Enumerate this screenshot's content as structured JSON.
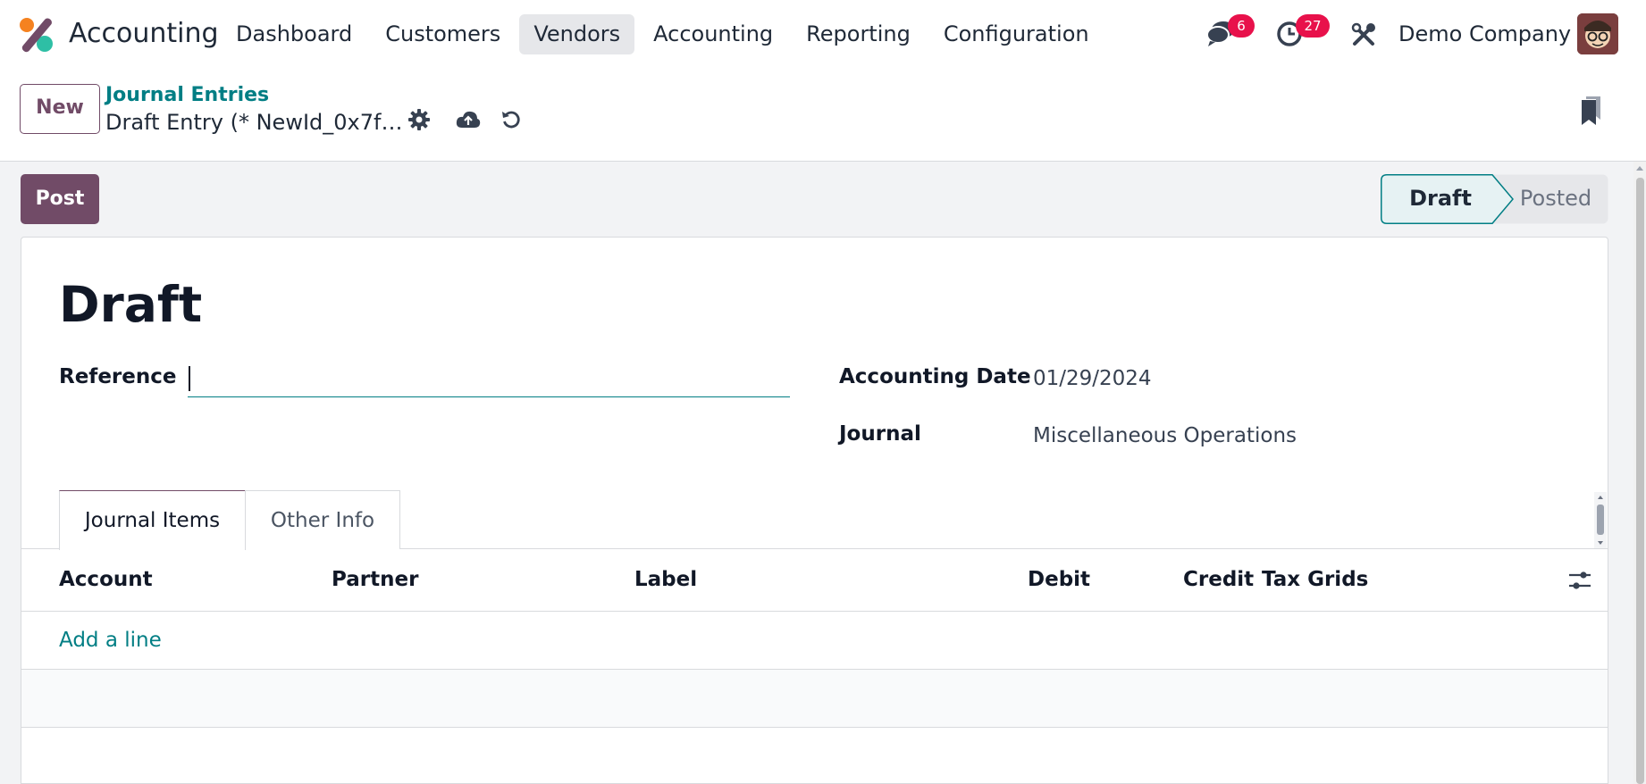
{
  "app": {
    "name": "Accounting",
    "brand_color": "#714b67",
    "accent_color": "#017e84"
  },
  "menu": {
    "items": [
      {
        "label": "Dashboard"
      },
      {
        "label": "Customers"
      },
      {
        "label": "Vendors",
        "active": true
      },
      {
        "label": "Accounting"
      },
      {
        "label": "Reporting"
      },
      {
        "label": "Configuration"
      }
    ]
  },
  "systray": {
    "messages_badge": "6",
    "activities_badge": "27",
    "company": "Demo Company",
    "icons": [
      "chat-icon",
      "clock-icon",
      "tools-icon",
      "avatar"
    ]
  },
  "control_panel": {
    "new_label": "New",
    "breadcrumb": "Journal Entries",
    "record_name": "Draft Entry (* NewId_0x7f…",
    "icons": [
      "gear-icon",
      "cloud-upload-icon",
      "discard-icon",
      "bookmark-icon"
    ]
  },
  "actions": {
    "post_label": "Post"
  },
  "status": {
    "draft": "Draft",
    "posted": "Posted",
    "current": "Draft"
  },
  "form": {
    "title": "Draft",
    "reference_label": "Reference",
    "reference_value": "",
    "date_label": "Accounting Date",
    "date_value": "01/29/2024",
    "journal_label": "Journal",
    "journal_value": "Miscellaneous Operations"
  },
  "tabs": [
    {
      "label": "Journal Items",
      "active": true
    },
    {
      "label": "Other Info",
      "active": false
    }
  ],
  "table": {
    "columns": [
      "Account",
      "Partner",
      "Label",
      "Debit",
      "Credit",
      "Tax Grids"
    ],
    "add_line": "Add a line",
    "rows": []
  }
}
